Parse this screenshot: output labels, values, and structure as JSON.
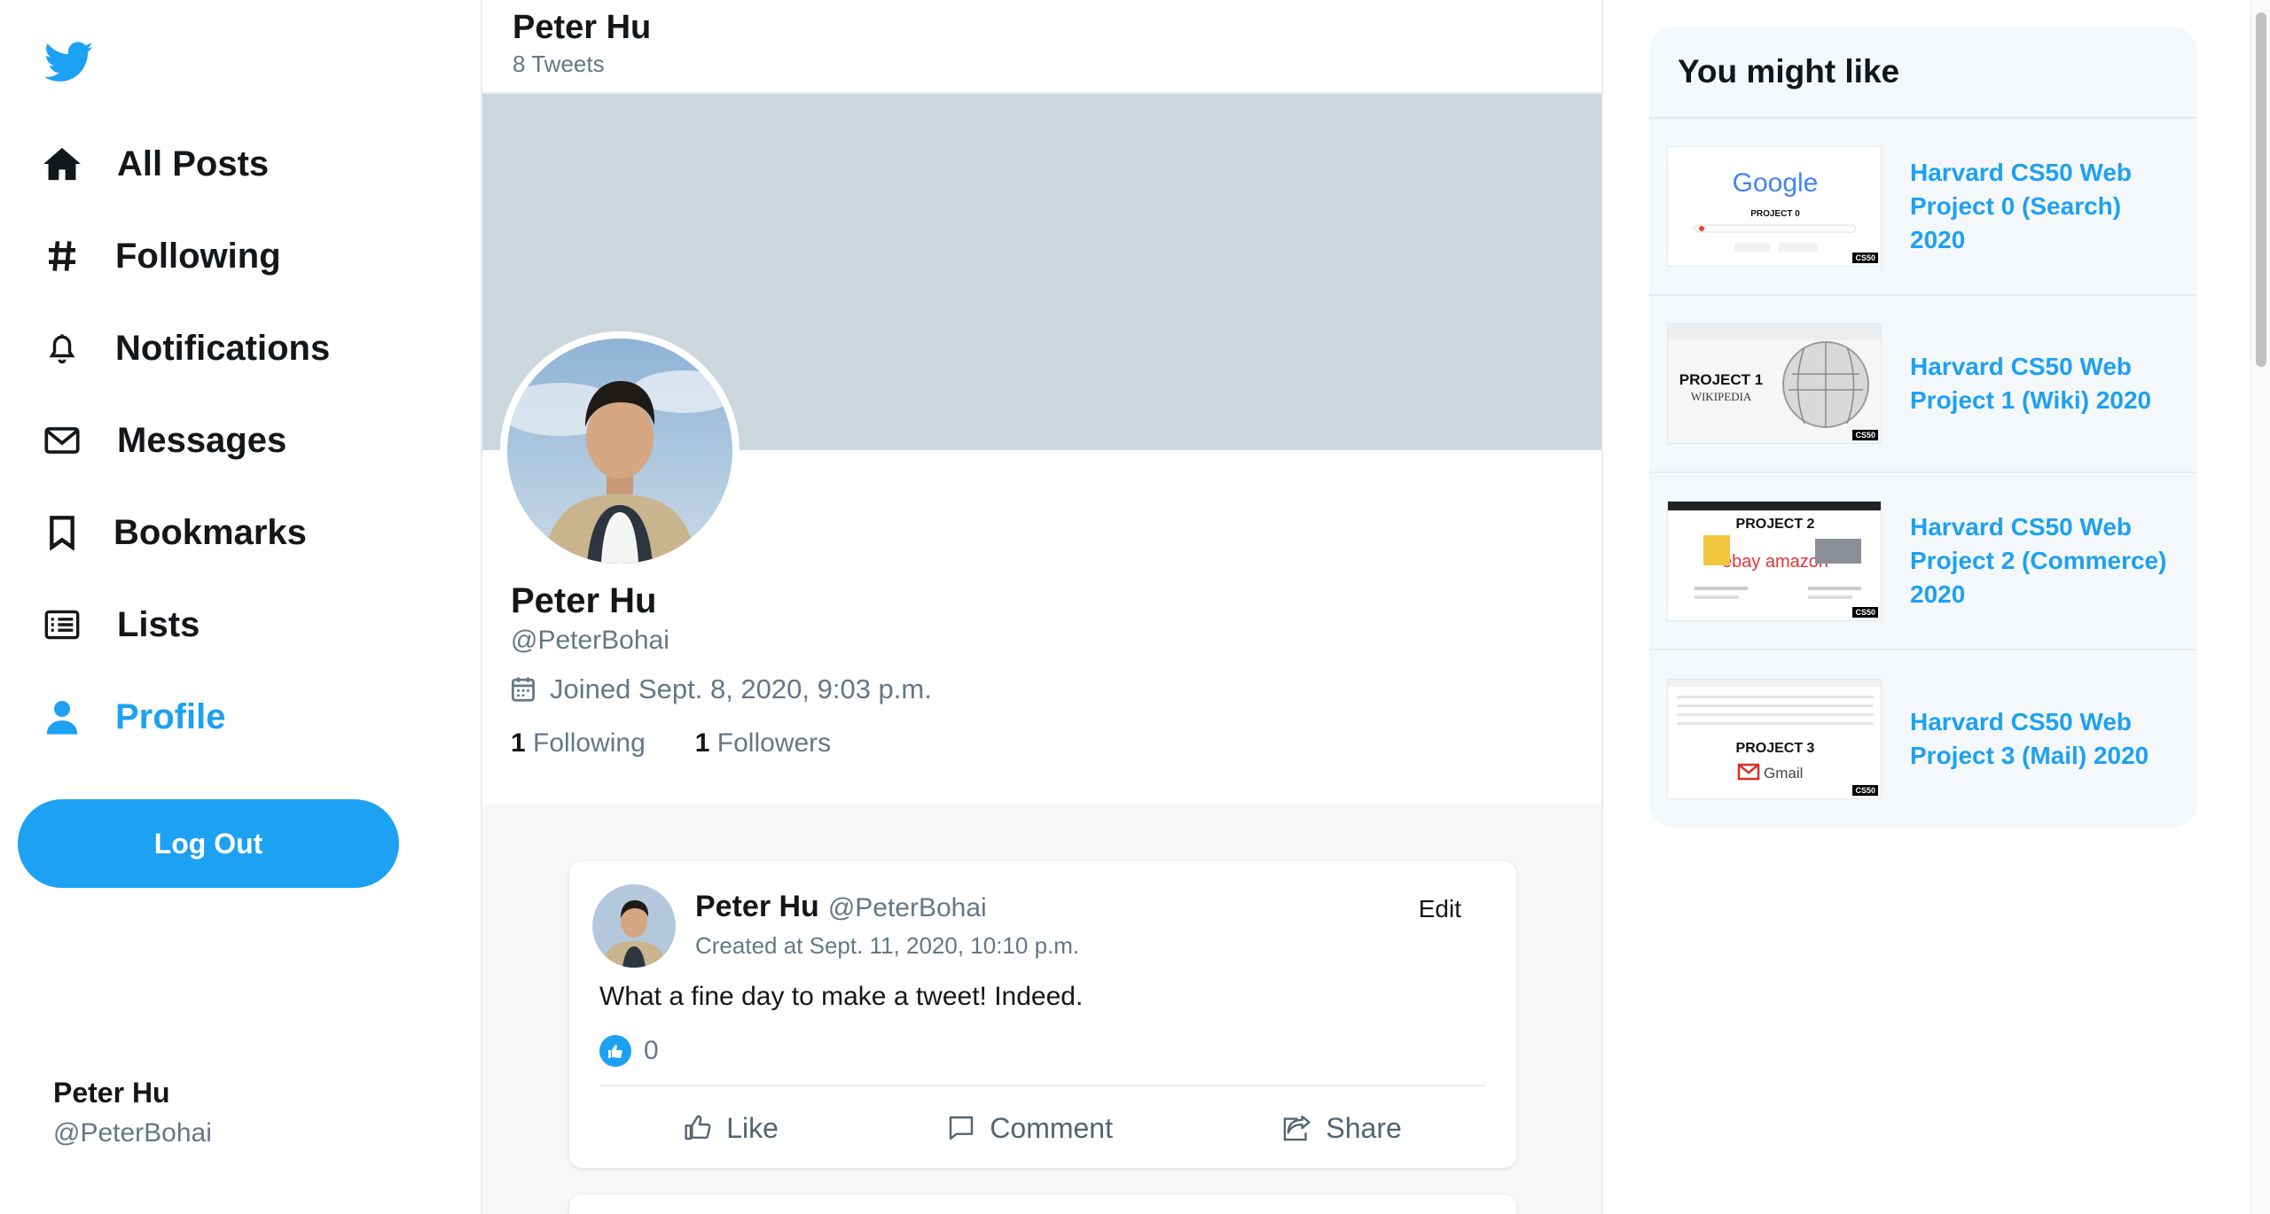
{
  "colors": {
    "accent": "#1da1f2",
    "banner": "#ccd6dd",
    "text": "#14171a",
    "muted": "#657786"
  },
  "sidebar": {
    "logo": "twitter-bird-icon",
    "items": [
      {
        "label": "All Posts",
        "icon": "home-icon"
      },
      {
        "label": "Following",
        "icon": "hashtag-icon"
      },
      {
        "label": "Notifications",
        "icon": "bell-icon"
      },
      {
        "label": "Messages",
        "icon": "envelope-icon"
      },
      {
        "label": "Bookmarks",
        "icon": "bookmark-icon"
      },
      {
        "label": "Lists",
        "icon": "list-icon"
      },
      {
        "label": "Profile",
        "icon": "user-icon",
        "active": true
      }
    ],
    "logout_label": "Log Out",
    "user": {
      "name": "Peter Hu",
      "handle": "@PeterBohai"
    }
  },
  "header": {
    "title": "Peter Hu",
    "subtitle": "8 Tweets"
  },
  "profile": {
    "name": "Peter Hu",
    "handle": "@PeterBohai",
    "joined": "Joined Sept. 8, 2020, 9:03 p.m.",
    "following_count": "1",
    "following_label": "Following",
    "followers_count": "1",
    "followers_label": "Followers"
  },
  "tweets": [
    {
      "name": "Peter Hu",
      "handle": "@PeterBohai",
      "edit_label": "Edit",
      "created": "Created at Sept. 11, 2020, 10:10 p.m.",
      "text": "What a fine day to make a tweet! Indeed.",
      "likes": "0",
      "actions": {
        "like": "Like",
        "comment": "Comment",
        "share": "Share"
      }
    }
  ],
  "suggestions": {
    "title": "You might like",
    "items": [
      {
        "label": "Harvard CS50 Web Project 0 (Search) 2020",
        "thumb_title": "PROJECT 0",
        "thumb_brand": "Google"
      },
      {
        "label": "Harvard CS50 Web Project 1 (Wiki) 2020",
        "thumb_title": "PROJECT 1",
        "thumb_brand": "WIKIPEDIA"
      },
      {
        "label": "Harvard CS50 Web Project 2 (Commerce) 2020",
        "thumb_title": "PROJECT 2",
        "thumb_brand": "ebay amazon"
      },
      {
        "label": "Harvard CS50 Web Project 3 (Mail) 2020",
        "thumb_title": "PROJECT 3",
        "thumb_brand": "Gmail"
      }
    ],
    "badge": "CS50"
  }
}
